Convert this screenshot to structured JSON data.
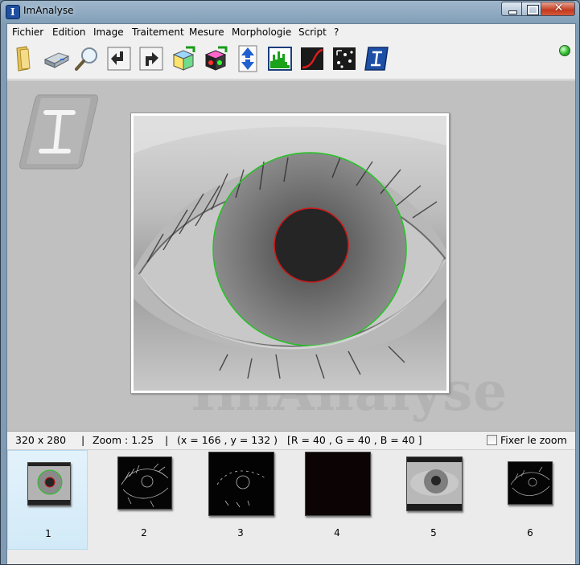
{
  "window": {
    "title": "ImAnalyse",
    "icon_letter": "I",
    "close_glyph": "✕"
  },
  "menu": [
    "Fichier",
    "Edition",
    "Image",
    "Traitement",
    "Mesure",
    "Morphologie",
    "Script",
    "?"
  ],
  "toolbar": [
    "open-folder",
    "drive",
    "zoom-magnifier",
    "undo",
    "redo",
    "rgb-cube",
    "color-cube",
    "vertical-flip",
    "histogram",
    "curve",
    "points",
    "imanalyse-logo"
  ],
  "viewer": {
    "watermark": "ImAnalyse",
    "logo_letter": "I"
  },
  "status": {
    "size": "320 x 280",
    "zoom": "Zoom : 1.25",
    "coords": "(x = 166 , y = 132 )",
    "rgb": "[R = 40 , G = 40 , B = 40 ]",
    "separator": "|",
    "fix_zoom_label": "Fixer le zoom"
  },
  "thumbnails": [
    {
      "label": "1",
      "kind": "color-eye",
      "selected": true
    },
    {
      "label": "2",
      "kind": "edges"
    },
    {
      "label": "3",
      "kind": "sparse-edges"
    },
    {
      "label": "4",
      "kind": "dark"
    },
    {
      "label": "5",
      "kind": "gray-eye"
    },
    {
      "label": "6",
      "kind": "edges"
    }
  ],
  "colors": {
    "iris_circle": "#22c422",
    "pupil_circle": "#d01818",
    "status_led": "#2bbd2b"
  }
}
